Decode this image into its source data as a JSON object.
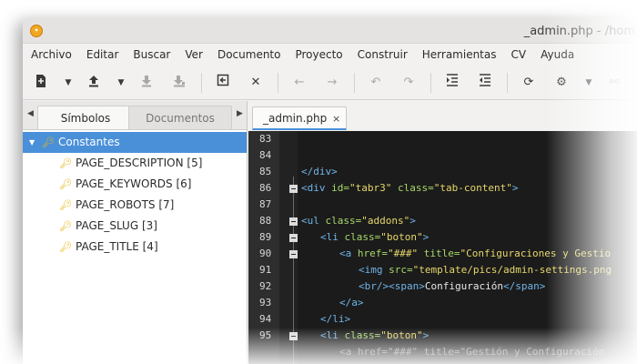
{
  "window": {
    "title": "_admin.php - /hom"
  },
  "menu": [
    "Archivo",
    "Editar",
    "Buscar",
    "Ver",
    "Documento",
    "Proyecto",
    "Construir",
    "Herramientas",
    "CV",
    "Ayuda"
  ],
  "toolbar_icons": [
    "new-icon",
    "dropdown-arrow-icon",
    "open-icon",
    "dropdown-arrow-icon",
    "save-icon",
    "save-all-icon",
    "revert-icon",
    "close-icon",
    "back-icon",
    "forward-icon",
    "undo-icon",
    "redo-icon",
    "indent-icon",
    "unindent-icon",
    "reload-icon",
    "settings-icon",
    "dropdown-arrow-icon",
    "link-icon"
  ],
  "sidebar": {
    "tabs": [
      "Símbolos",
      "Documentos"
    ],
    "tree": {
      "root": "Constantes",
      "items": [
        "PAGE_DESCRIPTION [5]",
        "PAGE_KEYWORDS [6]",
        "PAGE_ROBOTS [7]",
        "PAGE_SLUG [3]",
        "PAGE_TITLE [4]"
      ]
    }
  },
  "editor": {
    "tab": {
      "label": "_admin.php",
      "close": "×"
    },
    "line_numbers": [
      "83",
      "84",
      "85",
      "86",
      "87",
      "88",
      "89",
      "90",
      "91",
      "92",
      "93",
      "94",
      "95"
    ],
    "lines": [
      [],
      [],
      [
        {
          "t": "</div>",
          "c": "tag"
        }
      ],
      [
        {
          "t": "<div ",
          "c": "tag"
        },
        {
          "t": "id=",
          "c": "attr"
        },
        {
          "t": "\"tabr3\" ",
          "c": "str"
        },
        {
          "t": "class=",
          "c": "attr"
        },
        {
          "t": "\"tab-content\"",
          "c": "str"
        },
        {
          "t": ">",
          "c": "tag"
        }
      ],
      [],
      [
        {
          "t": "<ul ",
          "c": "tag"
        },
        {
          "t": "class=",
          "c": "attr"
        },
        {
          "t": "\"addons\"",
          "c": "str"
        },
        {
          "t": ">",
          "c": "tag"
        }
      ],
      [
        {
          "t": "<li ",
          "c": "tag"
        },
        {
          "t": "class=",
          "c": "attr"
        },
        {
          "t": "\"boton\"",
          "c": "str"
        },
        {
          "t": ">",
          "c": "tag"
        }
      ],
      [
        {
          "t": "<a ",
          "c": "tag"
        },
        {
          "t": "href=",
          "c": "attr"
        },
        {
          "t": "\"###\" ",
          "c": "str"
        },
        {
          "t": "title=",
          "c": "attr"
        },
        {
          "t": "\"Configuraciones y Gestio",
          "c": "str"
        }
      ],
      [
        {
          "t": "<img ",
          "c": "tag"
        },
        {
          "t": "src=",
          "c": "attr"
        },
        {
          "t": "\"template/pics/admin-settings.png",
          "c": "str"
        }
      ],
      [
        {
          "t": "<br/><span>",
          "c": "tag"
        },
        {
          "t": "Configuración",
          "c": "plain"
        },
        {
          "t": "</span>",
          "c": "tag"
        }
      ],
      [
        {
          "t": "</a>",
          "c": "tag"
        }
      ],
      [
        {
          "t": "</li>",
          "c": "tag"
        }
      ],
      [
        {
          "t": "<li ",
          "c": "tag"
        },
        {
          "t": "class=",
          "c": "attr"
        },
        {
          "t": "\"boton\"",
          "c": "str"
        },
        {
          "t": ">",
          "c": "tag"
        }
      ]
    ],
    "partial_line": "<a href=\"###\" title=\"Gestión y Configuración"
  },
  "colors": {
    "selection": "#4a90d9",
    "editor_bg": "#1b1b1b",
    "tag": "#6fb5e8",
    "attr": "#a8d86a",
    "string": "#e6d76a"
  }
}
